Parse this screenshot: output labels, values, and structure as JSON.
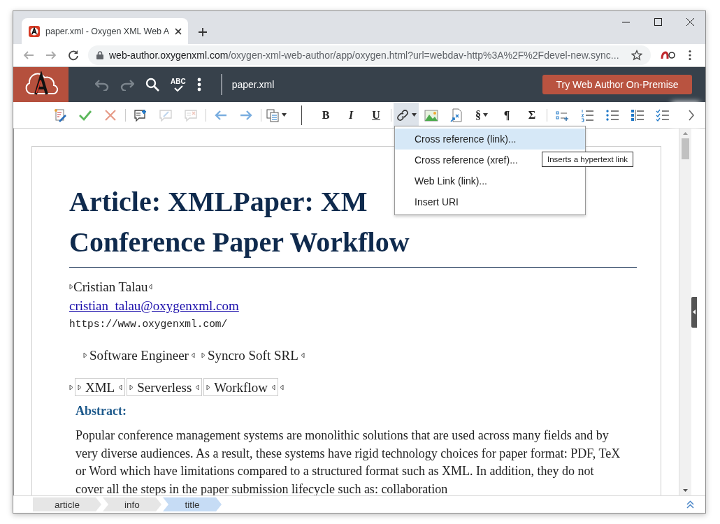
{
  "browser": {
    "tab": {
      "title": "paper.xml - Oxygen XML Web A",
      "selected": true
    },
    "address": {
      "host": "web-author.oxygenxml.com",
      "path": "/oxygen-xml-web-author/app/oxygen.html?url=webdav-http%3A%2F%2Fdevel-new.sync..."
    }
  },
  "app_header": {
    "tools": [
      {
        "kind": "undo",
        "disabled": true
      },
      {
        "kind": "redo",
        "disabled": true
      },
      {
        "kind": "search",
        "disabled": false
      },
      {
        "kind": "spellcheck",
        "label": "ABC",
        "disabled": false
      },
      {
        "kind": "more",
        "disabled": false
      }
    ],
    "file_name": "paper.xml",
    "cta_button": "Try Web Author On-Premise"
  },
  "toolbar": [
    {
      "kind": "track-changes",
      "disabled": false
    },
    {
      "kind": "accept",
      "disabled": false
    },
    {
      "kind": "reject",
      "disabled": false
    },
    {
      "kind": "separator"
    },
    {
      "kind": "add-comment",
      "disabled": false
    },
    {
      "kind": "edit-comment",
      "disabled": true
    },
    {
      "kind": "remove-comment",
      "disabled": true
    },
    {
      "kind": "separator"
    },
    {
      "kind": "back",
      "disabled": false
    },
    {
      "kind": "forward",
      "disabled": false
    },
    {
      "kind": "separator"
    },
    {
      "kind": "paste",
      "disabled": false,
      "dropdown": true
    },
    {
      "kind": "divider"
    },
    {
      "kind": "bold",
      "label": "B",
      "disabled": false
    },
    {
      "kind": "italic",
      "label": "I",
      "disabled": false
    },
    {
      "kind": "underline",
      "label": "U",
      "disabled": false
    },
    {
      "kind": "separator"
    },
    {
      "kind": "link",
      "disabled": false,
      "dropdown": true,
      "expanded": true
    },
    {
      "kind": "image",
      "disabled": false
    },
    {
      "kind": "insert-xref",
      "disabled": false
    },
    {
      "kind": "symbol",
      "label": "§",
      "disabled": false,
      "dropdown": true
    },
    {
      "kind": "symbol",
      "label": "¶",
      "disabled": false
    },
    {
      "kind": "symbol",
      "label": "Σ",
      "disabled": false
    },
    {
      "kind": "separator"
    },
    {
      "kind": "insert-list-item",
      "disabled": false
    },
    {
      "kind": "ordered-list",
      "disabled": false
    },
    {
      "kind": "unordered-list",
      "disabled": false
    },
    {
      "kind": "definition-list",
      "disabled": false
    },
    {
      "kind": "task-list",
      "disabled": false
    }
  ],
  "link_menu": {
    "items": [
      {
        "label": "Cross reference (link)...",
        "selected": true
      },
      {
        "label": "Cross reference (xref)...",
        "selected": false
      },
      {
        "label": "Web Link (link)...",
        "selected": false
      },
      {
        "label": "Insert URI",
        "selected": false
      }
    ],
    "tooltip": "Inserts a hypertext link"
  },
  "document": {
    "title_lines": [
      "Article: XMLPaper: XM",
      "Conference Paper Workflow"
    ],
    "author": "Cristian Talau",
    "email": "cristian_talau@oxygenxml.com",
    "url": "https://www.oxygenxml.com/",
    "affiliation": [
      "Software Engineer",
      "Syncro Soft SRL"
    ],
    "keywords": [
      "XML",
      "Serverless",
      "Workflow"
    ],
    "abstract_heading": "Abstract:",
    "abstract_text": "Popular conference management systems are monolithic solutions that are used across many fields and by very diverse audiences. As a result, these systems have rigid technology choices for paper format: PDF, TeX or Word which have limitations compared to a structured format such as XML. In addition, they do not cover all the steps in the paper submission lifecycle such as: collaboration"
  },
  "breadcrumbs": [
    {
      "label": "article",
      "selected": false
    },
    {
      "label": "info",
      "selected": false
    },
    {
      "label": "title",
      "selected": true
    }
  ]
}
